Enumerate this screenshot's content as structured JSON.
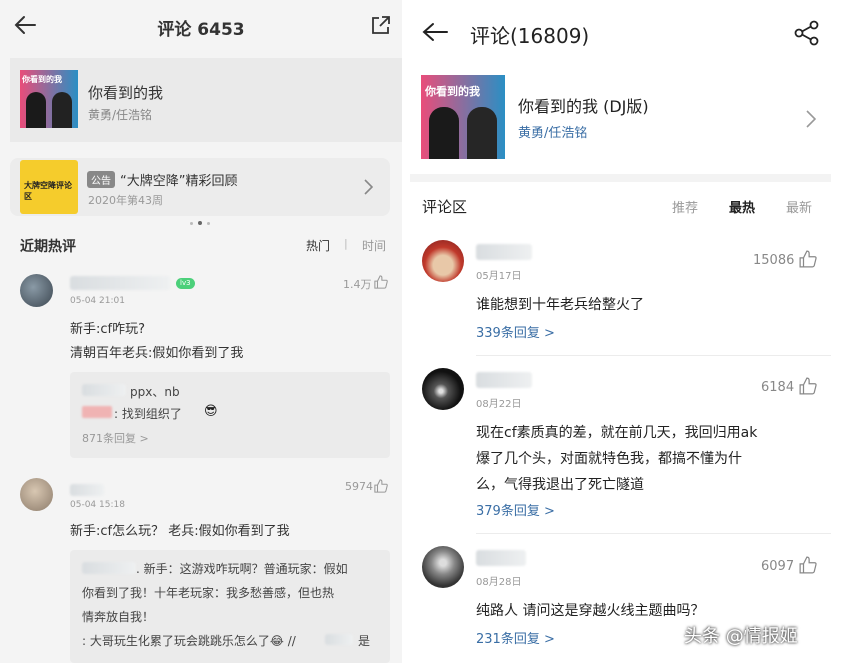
{
  "left": {
    "header": {
      "title": "评论 6453"
    },
    "song": {
      "title": "你看到的我",
      "artist": "黄勇/任浩铭",
      "cover_text": "你看到的我"
    },
    "announcement": {
      "tag": "公告",
      "title": "“大牌空降”精彩回顾",
      "subtitle": "2020年第43周",
      "cover_text": "大牌空降评论区"
    },
    "section": {
      "title": "近期热评",
      "sort_hot": "热门",
      "divider": "|",
      "sort_time": "时间"
    },
    "comments": [
      {
        "badge": "lv3",
        "date": "05-04 21:01",
        "likes": "1.4万",
        "lines": [
          "新手:cf咋玩?",
          "清朝百年老兵:假如你看到了我"
        ],
        "replies": [
          {
            "text": "ppx、nb",
            "emoji": ""
          },
          {
            "text": ": 找到组织了",
            "emoji": "😎"
          }
        ],
        "reply_count": "871条回复 >"
      },
      {
        "date": "05-04 15:18",
        "likes": "5974",
        "lines": [
          "新手:cf怎么玩？ 老兵:假如你看到了我"
        ],
        "reply_lines": [
          ". 新手：这游戏咋玩啊？普通玩家：假如",
          "你看到了我！十年老玩家：我多愁善感，但也热",
          "情奔放自我！",
          ": 大哥玩生化累了玩会跳跳乐怎么了😂 //",
          "是"
        ]
      }
    ]
  },
  "right": {
    "header": {
      "title": "评论(16809)"
    },
    "song": {
      "title": "你看到的我 (DJ版)",
      "artist": "黄勇/任浩铭",
      "cover_text": "你看到的我"
    },
    "section": {
      "title": "评论区",
      "tab_recommend": "推荐",
      "tab_hot": "最热",
      "tab_new": "最新"
    },
    "comments": [
      {
        "date": "05月17日",
        "likes": "15086",
        "lines": [
          "谁能想到十年老兵给整火了"
        ],
        "reply_count": "339条回复 >"
      },
      {
        "date": "08月22日",
        "likes": "6184",
        "lines": [
          "现在cf素质真的差，就在前几天，我回归用ak",
          "爆了几个头，对面就特色我，都搞不懂为什",
          "么，气得我退出了死亡隧道"
        ],
        "reply_count": "379条回复 >"
      },
      {
        "date": "08月28日",
        "likes": "6097",
        "lines": [
          "纯路人 请问这是穿越火线主题曲吗？"
        ],
        "reply_count": "231条回复 >"
      }
    ],
    "watermark": "头条 @情报姬"
  },
  "colors": {
    "link_blue": "#3a6ea5",
    "badge_green": "#4cd07a",
    "announce_yellow": "#f5cc2c"
  },
  "icons": [
    "back-arrow-icon",
    "share-icon",
    "chevron-right-icon",
    "thumbs-up-icon"
  ]
}
